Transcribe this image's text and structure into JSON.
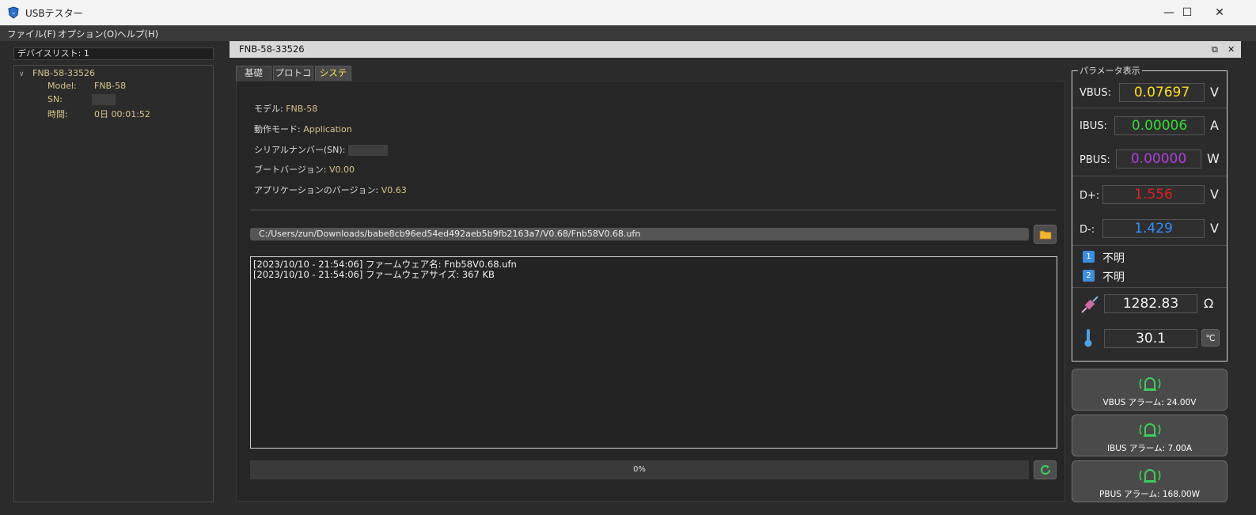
{
  "window": {
    "title": "USBテスター",
    "minimize": "—",
    "maximize": "☐",
    "close": "✕"
  },
  "menu": [
    "ファイル(F)",
    "オプション(O)",
    "ヘルプ(H)"
  ],
  "device_list": {
    "header": "デバイスリスト: 1",
    "device_name": "FNB-58-33526",
    "model_label": "Model:",
    "model_value": "FNB-58",
    "sn_label": "SN:",
    "time_label": "時間:",
    "time_value": "0日 00:01:52"
  },
  "document": {
    "title": "FNB-58-33526",
    "restore_icon": "⧉",
    "close_icon": "✕"
  },
  "tabs": [
    "基礎",
    "プロトコル",
    "システム"
  ],
  "active_tab": "システム",
  "system_info": {
    "model_label": "モデル:",
    "model_value": "FNB-58",
    "mode_label": "動作モード:",
    "mode_value": "Application",
    "serial_label": "シリアルナンバー(SN):",
    "boot_label": "ブートバージョン:",
    "boot_value": "V0.00",
    "app_label": "アプリケーションのバージョン:",
    "app_value": "V0.63"
  },
  "firmware": {
    "path": "C:/Users/zun/Downloads/babe8cb96ed54ed492aeb5b9fb2163a7/V0.68/Fnb58V0.68.ufn",
    "log": [
      "[2023/10/10 - 21:54:06] ファームウェア名: Fnb58V0.68.ufn",
      "[2023/10/10 - 21:54:06] ファームウェアサイズ: 367 KB"
    ],
    "progress_text": "0%",
    "progress_fraction": 0
  },
  "parameters": {
    "title": "パラメータ表示",
    "vbus": {
      "label": "VBUS:",
      "value": "0.07697",
      "unit": "V",
      "color": "#ffe01a"
    },
    "ibus": {
      "label": "IBUS:",
      "value": "0.00006",
      "unit": "A",
      "color": "#33dd33"
    },
    "pbus": {
      "label": "PBUS:",
      "value": "0.00000",
      "unit": "W",
      "color": "#b040d8"
    },
    "dplus": {
      "label": "D+:",
      "value": "1.556",
      "unit": "V",
      "color": "#e02020"
    },
    "dminus": {
      "label": "D-:",
      "value": "1.429",
      "unit": "V",
      "color": "#2f8fff"
    },
    "proto1": {
      "badge": "1",
      "text": "不明"
    },
    "proto2": {
      "badge": "2",
      "text": "不明"
    },
    "resistance": {
      "value": "1282.83",
      "unit": "Ω"
    },
    "temperature": {
      "value": "30.1",
      "unit": "℃"
    }
  },
  "alarms": [
    {
      "label": "VBUS アラーム: 24.00V"
    },
    {
      "label": "IBUS アラーム: 7.00A"
    },
    {
      "label": "PBUS アラーム: 168.00W"
    }
  ]
}
